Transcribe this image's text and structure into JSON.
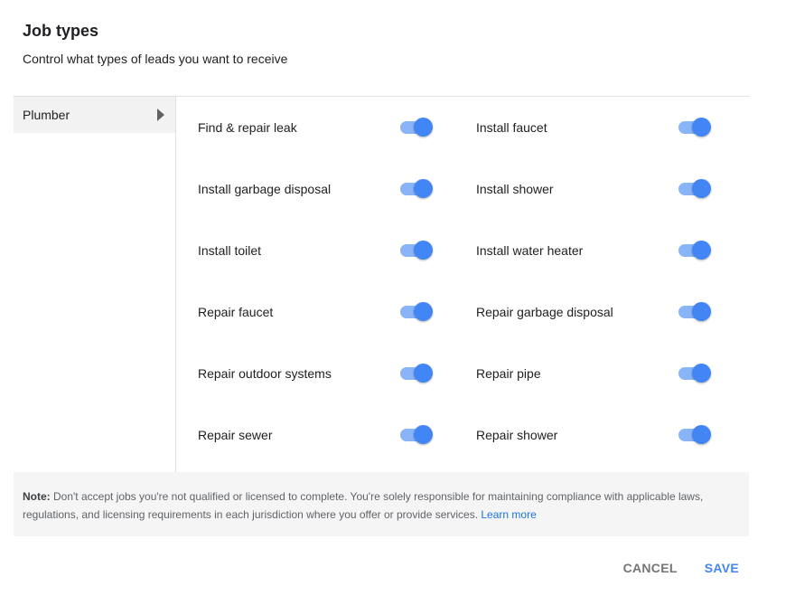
{
  "header": {
    "title": "Job types",
    "subtitle": "Control what types of leads you want to receive"
  },
  "categories": [
    {
      "label": "Plumber",
      "selected": true
    }
  ],
  "jobs": [
    {
      "label": "Find & repair leak",
      "enabled": true
    },
    {
      "label": "Install faucet",
      "enabled": true
    },
    {
      "label": "Install garbage disposal",
      "enabled": true
    },
    {
      "label": "Install shower",
      "enabled": true
    },
    {
      "label": "Install toilet",
      "enabled": true
    },
    {
      "label": "Install water heater",
      "enabled": true
    },
    {
      "label": "Repair faucet",
      "enabled": true
    },
    {
      "label": "Repair garbage disposal",
      "enabled": true
    },
    {
      "label": "Repair outdoor systems",
      "enabled": true
    },
    {
      "label": "Repair pipe",
      "enabled": true
    },
    {
      "label": "Repair sewer",
      "enabled": true
    },
    {
      "label": "Repair shower",
      "enabled": true
    }
  ],
  "note": {
    "prefix": "Note:",
    "text": " Don't accept jobs you're not qualified or licensed to complete. You're solely responsible for maintaining compliance with applicable laws, regulations, and licensing requirements in each jurisdiction where you offer or provide services. ",
    "link": "Learn more"
  },
  "actions": {
    "cancel": "CANCEL",
    "save": "SAVE"
  },
  "colors": {
    "accent": "#4285f4",
    "track": "#8ab4f8",
    "link": "#1a73e8"
  }
}
